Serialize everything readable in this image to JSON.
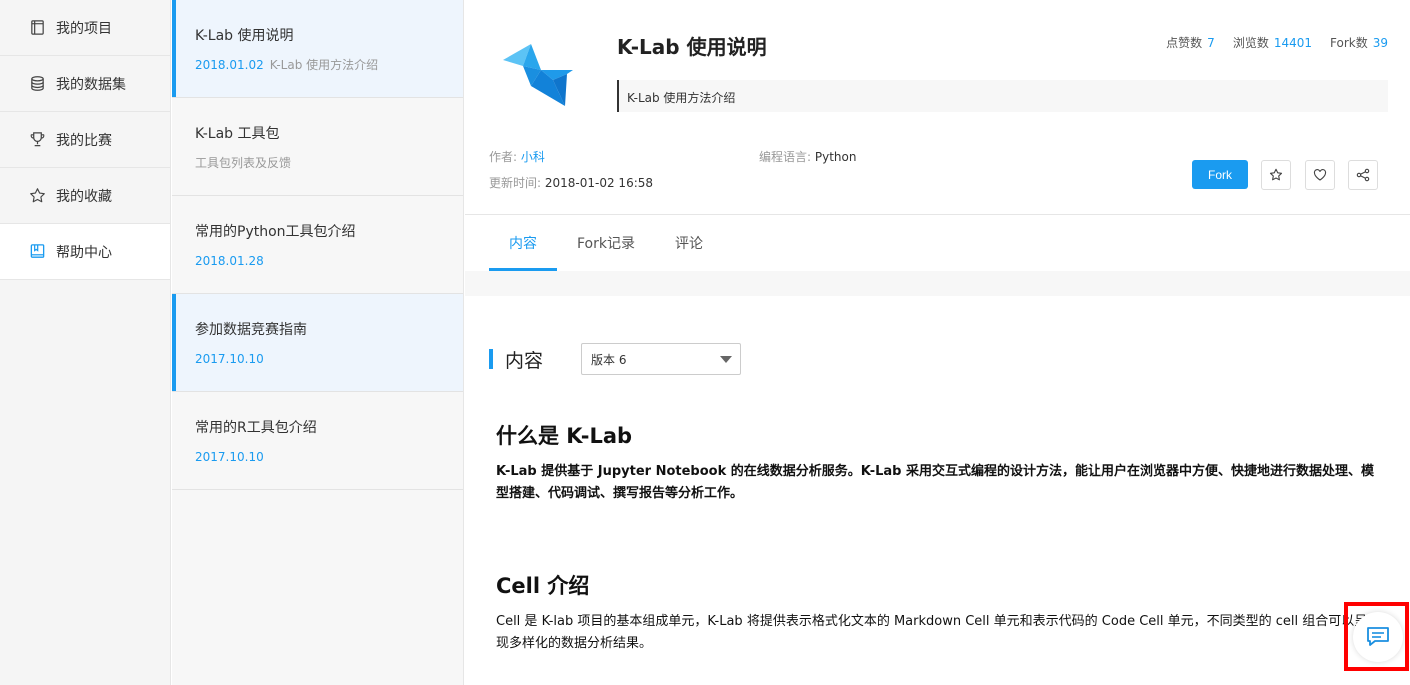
{
  "nav": {
    "items": [
      {
        "label": "我的项目",
        "icon": "book-icon"
      },
      {
        "label": "我的数据集",
        "icon": "database-icon"
      },
      {
        "label": "我的比赛",
        "icon": "trophy-icon"
      },
      {
        "label": "我的收藏",
        "icon": "star-icon"
      },
      {
        "label": "帮助中心",
        "icon": "help-book-icon",
        "active": true
      }
    ]
  },
  "docs": [
    {
      "title": "K-Lab 使用说明",
      "date": "2018.01.02",
      "desc": "K-Lab 使用方法介绍",
      "selected": true
    },
    {
      "title": "K-Lab 工具包",
      "date": "",
      "desc": "工具包列表及反馈"
    },
    {
      "title": "常用的Python工具包介绍",
      "date": "2018.01.28",
      "desc": ""
    },
    {
      "title": "参加数据竞赛指南",
      "date": "2017.10.10",
      "desc": "",
      "selected": true
    },
    {
      "title": "常用的R工具包介绍",
      "date": "2017.10.10",
      "desc": ""
    }
  ],
  "project": {
    "title": "K-Lab 使用说明",
    "description": "K-Lab 使用方法介绍",
    "stats": {
      "likes_label": "点赞数",
      "likes": "7",
      "views_label": "浏览数",
      "views": "14401",
      "forks_label": "Fork数",
      "forks": "39"
    },
    "author_label": "作者:",
    "author": "小科",
    "language_label": "编程语言:",
    "language": "Python",
    "updated_label": "更新时间:",
    "updated": "2018-01-02 16:58",
    "fork_button": "Fork"
  },
  "tabs": [
    "内容",
    "Fork记录",
    "评论"
  ],
  "section": {
    "title": "内容",
    "version": "版本 6"
  },
  "content": {
    "h1": "什么是 K-Lab",
    "p1": "K-Lab 提供基于 Jupyter Notebook 的在线数据分析服务。K-Lab 采用交互式编程的设计方法，能让用户在浏览器中方便、快捷地进行数据处理、模型搭建、代码调试、撰写报告等分析工作。",
    "h2": "Cell 介绍",
    "p2": "Cell 是 K-lab 项目的基本组成单元，K-Lab 将提供表示格式化文本的 Markdown Cell 单元和表示代码的 Code Cell 单元，不同类型的 cell 组合可以呈现多样化的数据分析结果。"
  },
  "colors": {
    "accent": "#1a9bf0",
    "highlight": "#ff0000"
  }
}
